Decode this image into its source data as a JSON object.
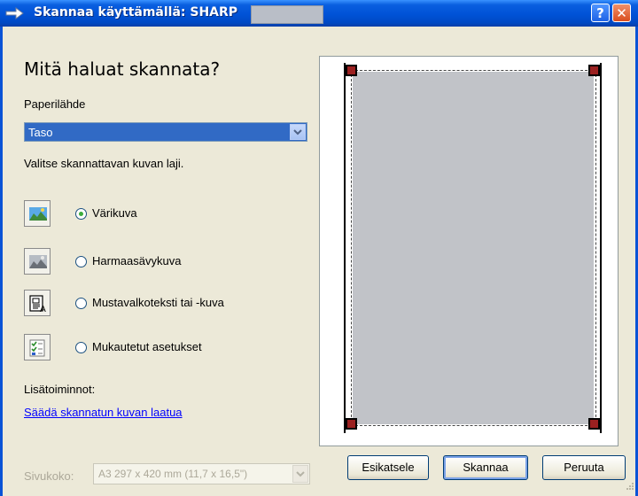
{
  "window": {
    "title": "Skannaa käyttämällä: SHARP",
    "help_label": "?",
    "close_label": "✕"
  },
  "main": {
    "heading": "Mitä haluat skannata?",
    "paper_source_label": "Paperilähde",
    "paper_source_value": "Taso",
    "picture_type_label": "Valitse skannattavan kuvan laji.",
    "options": [
      {
        "label": "Värikuva",
        "selected": true,
        "icon": "color-picture-icon"
      },
      {
        "label": "Harmaasävykuva",
        "selected": false,
        "icon": "grayscale-picture-icon"
      },
      {
        "label": "Mustavalkoteksti tai -kuva",
        "selected": false,
        "icon": "black-white-text-icon"
      },
      {
        "label": "Mukautetut asetukset",
        "selected": false,
        "icon": "custom-settings-icon"
      }
    ],
    "extra_label": "Lisätoiminnot:",
    "adjust_link": "Säädä skannatun kuvan laatua",
    "page_size_label": "Sivukoko:",
    "page_size_value": "A3 297 x 420 mm (11,7 x 16,5\")"
  },
  "buttons": {
    "preview": "Esikatsele",
    "scan": "Skannaa",
    "cancel": "Peruuta"
  },
  "colors": {
    "titlebar": "#0052d6",
    "selection": "#316ac5",
    "link": "#0000ff",
    "handle": "#9b2020",
    "preview_area": "#c1c3c8"
  }
}
